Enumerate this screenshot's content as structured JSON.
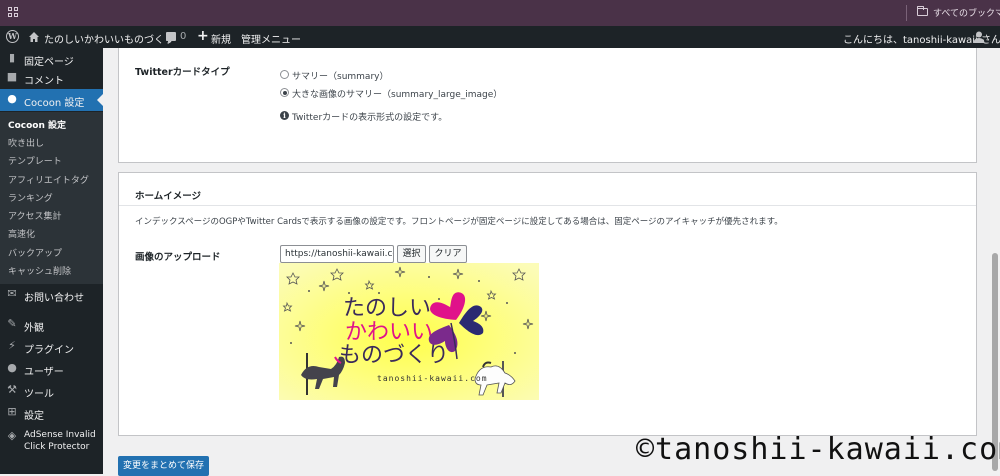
{
  "bookmarks_bar": {
    "all_bookmarks": "すべてのブックマーク"
  },
  "admin_bar": {
    "site_name": "たのしいかわいいものづくり",
    "comments_count": "0",
    "new_label": "新規",
    "admin_menu": "管理メニュー",
    "greeting": "こんにちは、tanoshii-kawaii さん"
  },
  "sidebar": {
    "items": [
      {
        "label": "固定ページ",
        "icon": "page-icon"
      },
      {
        "label": "コメント",
        "icon": "comment-icon"
      },
      {
        "label": "Cocoon 設定",
        "icon": "cocoon-icon"
      },
      {
        "label": "お問い合わせ",
        "icon": "mail-icon"
      },
      {
        "label": "外観",
        "icon": "brush-icon"
      },
      {
        "label": "プラグイン",
        "icon": "plugin-icon"
      },
      {
        "label": "ユーザー",
        "icon": "user-icon"
      },
      {
        "label": "ツール",
        "icon": "wrench-icon"
      },
      {
        "label": "設定",
        "icon": "settings-icon"
      },
      {
        "label": "AdSense Invalid",
        "label2": "Click Protector",
        "icon": "shield-icon"
      }
    ],
    "submenu": [
      "Cocoon 設定",
      "吹き出し",
      "テンプレート",
      "アフィリエイトタグ",
      "ランキング",
      "アクセス集計",
      "高速化",
      "バックアップ",
      "キャッシュ削除"
    ]
  },
  "twitter_card": {
    "label": "Twitterカードタイプ",
    "options": [
      "サマリー（summary）",
      "大きな画像のサマリー（summary_large_image）"
    ],
    "selected_index": 1,
    "note": "Twitterカードの表示形式の設定です。"
  },
  "home_image": {
    "heading": "ホームイメージ",
    "description": "インデックスページのOGPやTwitter Cardsで表示する画像の設定です。フロントページが固定ページに設定してある場合は、固定ページのアイキャッチが優先されます。",
    "upload_label": "画像のアップロード",
    "url_value": "https://tanoshii-kawaii.com",
    "select_button": "選択",
    "clear_button": "クリア",
    "hero": {
      "line1": "たのしい",
      "line2": "かわいい",
      "line3": "ものづくり",
      "site": "tanoshii-kawaii.com",
      "colors": {
        "bg_center": "#ffff4a",
        "bg_edge": "#fcfcb8",
        "heart_magenta": "#e0128a",
        "heart_purple": "#7b2a8c",
        "heart_navy": "#2b2a72",
        "text_pink": "#e0128a"
      }
    }
  },
  "save_button": "変更をまとめて保存",
  "watermark": "©tanoshii-kawaii.com"
}
